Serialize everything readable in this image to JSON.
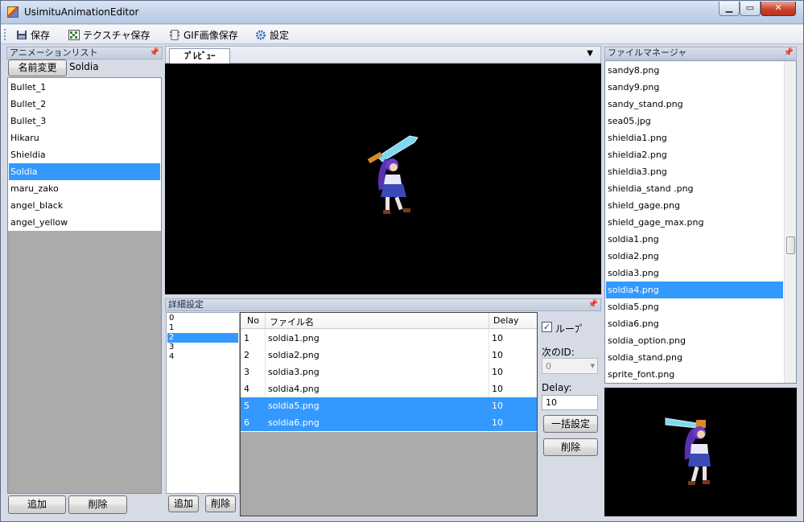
{
  "window": {
    "title": "UsimituAnimationEditor"
  },
  "menu": [
    {
      "label": "保存",
      "icon": "floppy-save-icon"
    },
    {
      "label": "テクスチャ保存",
      "icon": "texture-grid-icon"
    },
    {
      "label": "GIF画像保存",
      "icon": "gif-film-icon"
    },
    {
      "label": "設定",
      "icon": "gear-icon"
    }
  ],
  "anim_panel": {
    "title": "アニメーションリスト",
    "rename_label": "名前変更",
    "name_value": "Soldia",
    "items": [
      "Bullet_1",
      "Bullet_2",
      "Bullet_3",
      "Hikaru",
      "Shieldia",
      "Soldia",
      "maru_zako",
      "angel_black",
      "angel_yellow"
    ],
    "selected": "Soldia",
    "add_label": "追加",
    "delete_label": "削除"
  },
  "preview": {
    "tab_label": "ﾌﾟﾚﾋﾞｭｰ"
  },
  "detail": {
    "title": "詳細設定",
    "ids": [
      "0",
      "1",
      "2",
      "3",
      "4"
    ],
    "selected_id": "2",
    "add_label": "追加",
    "delete_label": "削除",
    "columns": [
      "No",
      "ファイル名",
      "Delay"
    ],
    "rows": [
      {
        "no": "1",
        "file": "soldia1.png",
        "delay": "10"
      },
      {
        "no": "2",
        "file": "soldia2.png",
        "delay": "10"
      },
      {
        "no": "3",
        "file": "soldia3.png",
        "delay": "10"
      },
      {
        "no": "4",
        "file": "soldia4.png",
        "delay": "10"
      },
      {
        "no": "5",
        "file": "soldia5.png",
        "delay": "10"
      },
      {
        "no": "6",
        "file": "soldia6.png",
        "delay": "10"
      }
    ],
    "selected_rows": [
      "5",
      "6"
    ],
    "loop_label": "ルーﾌﾟ",
    "loop_checked": true,
    "next_id_label": "次のID:",
    "next_id_value": "0",
    "delay_label": "Delay:",
    "delay_value": "10",
    "bulk_label": "一括設定",
    "delete_label2": "削除"
  },
  "file_manager": {
    "title": "ファイルマネージャ",
    "files": [
      "sandy8.png",
      "sandy9.png",
      "sandy_stand.png",
      "sea05.jpg",
      "shieldia1.png",
      "shieldia2.png",
      "shieldia3.png",
      "shieldia_stand .png",
      "shield_gage.png",
      "shield_gage_max.png",
      "soldia1.png",
      "soldia2.png",
      "soldia3.png",
      "soldia4.png",
      "soldia5.png",
      "soldia6.png",
      "soldia_option.png",
      "soldia_stand.png",
      "sprite_font.png"
    ],
    "selected": "soldia4.png"
  },
  "colors": {
    "selection": "#3399ff",
    "preview_bg": "#000000"
  }
}
